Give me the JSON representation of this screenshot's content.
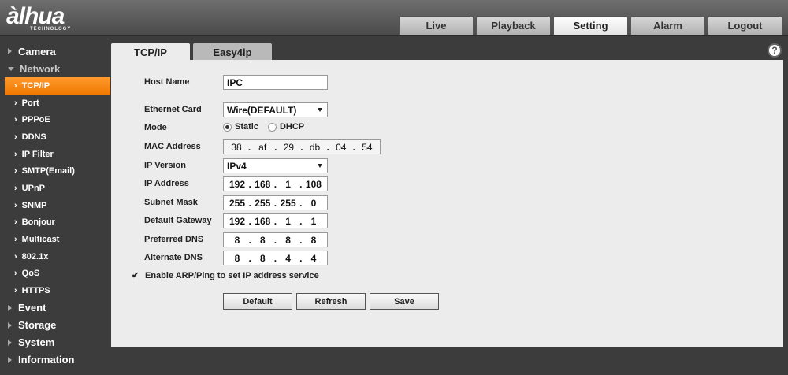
{
  "brand": {
    "logo": "àlhua",
    "tagline": "TECHNOLOGY"
  },
  "top_nav": [
    {
      "label": "Live"
    },
    {
      "label": "Playback"
    },
    {
      "label": "Setting",
      "active": true
    },
    {
      "label": "Alarm"
    },
    {
      "label": "Logout"
    }
  ],
  "sidebar": {
    "camera": "Camera",
    "network": "Network",
    "network_items": [
      "TCP/IP",
      "Port",
      "PPPoE",
      "DDNS",
      "IP Filter",
      "SMTP(Email)",
      "UPnP",
      "SNMP",
      "Bonjour",
      "Multicast",
      "802.1x",
      "QoS",
      "HTTPS"
    ],
    "active_item": "TCP/IP",
    "event": "Event",
    "storage": "Storage",
    "system": "System",
    "information": "Information"
  },
  "tabs": [
    "TCP/IP",
    "Easy4ip"
  ],
  "help_icon": "?",
  "form": {
    "host_name_label": "Host Name",
    "host_name_value": "IPC",
    "ethernet_card_label": "Ethernet Card",
    "ethernet_card_value": "Wire(DEFAULT)",
    "mode_label": "Mode",
    "mode_static": "Static",
    "mode_dhcp": "DHCP",
    "mode_selected": "Static",
    "mac_label": "MAC Address",
    "mac": [
      "38",
      "af",
      "29",
      "db",
      "04",
      "54"
    ],
    "ip_version_label": "IP Version",
    "ip_version_value": "IPv4",
    "ip_address_label": "IP Address",
    "ip_address": [
      "192",
      "168",
      "1",
      "108"
    ],
    "subnet_label": "Subnet Mask",
    "subnet": [
      "255",
      "255",
      "255",
      "0"
    ],
    "gateway_label": "Default Gateway",
    "gateway": [
      "192",
      "168",
      "1",
      "1"
    ],
    "pdns_label": "Preferred DNS",
    "pdns": [
      "8",
      "8",
      "8",
      "8"
    ],
    "adns_label": "Alternate DNS",
    "adns": [
      "8",
      "8",
      "4",
      "4"
    ],
    "arp_label": "Enable ARP/Ping to set IP address service",
    "arp_checked": true
  },
  "buttons": {
    "default": "Default",
    "refresh": "Refresh",
    "save": "Save"
  }
}
